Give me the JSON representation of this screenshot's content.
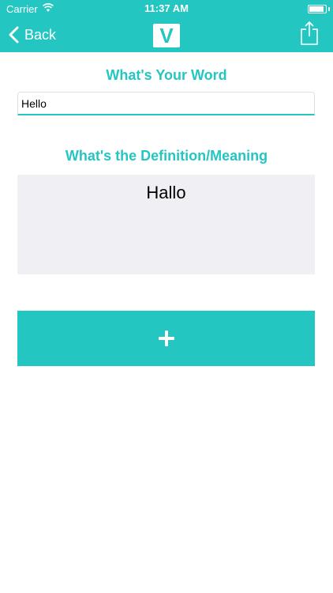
{
  "status_bar": {
    "carrier": "Carrier",
    "time": "11:37 AM",
    "battery_level": 0.95
  },
  "nav": {
    "back_label": "Back",
    "logo_text": "V"
  },
  "word": {
    "heading": "What's Your Word",
    "value": "Hello"
  },
  "definition": {
    "heading": "What's the Definition/Meaning",
    "value": "Hallo"
  },
  "colors": {
    "accent": "#24c6c2",
    "definition_bg": "#efeff4"
  },
  "icons": {
    "back": "chevron-left-icon",
    "share": "share-icon",
    "add": "plus-icon"
  }
}
